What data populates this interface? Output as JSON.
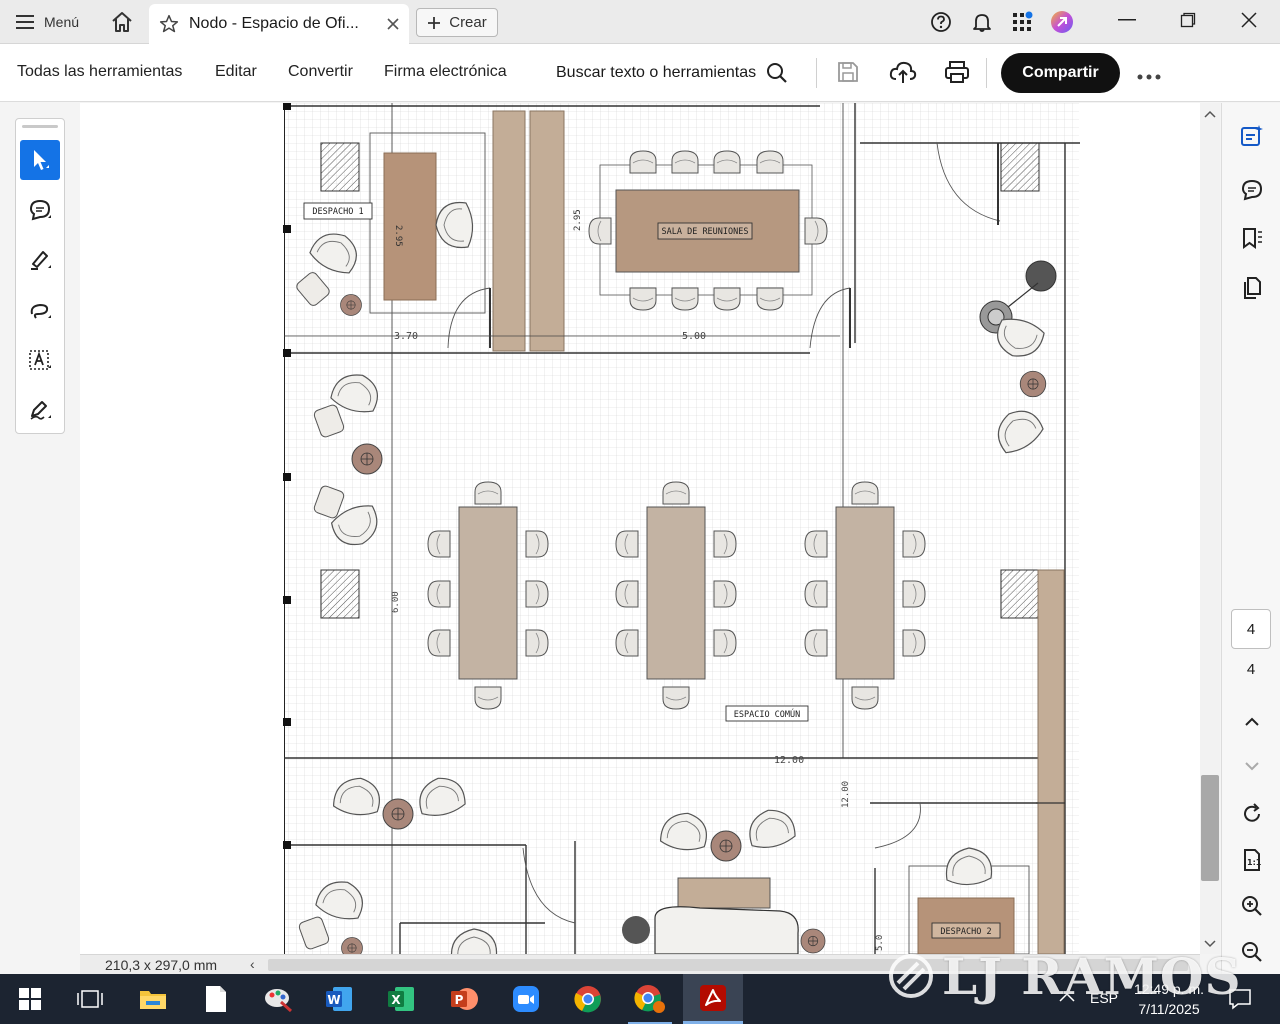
{
  "titlebar": {
    "menu_label": "Menú",
    "tab_title": "Nodo - Espacio de Ofi...",
    "create_label": "Crear"
  },
  "toolbar": {
    "items": [
      "Todas las herramientas",
      "Editar",
      "Convertir",
      "Firma electrónica"
    ],
    "search_label": "Buscar texto o herramientas",
    "share_label": "Compartir"
  },
  "floorplan": {
    "labels": {
      "office1": "DESPACHO 1",
      "meeting": "SALA DE REUNIONES",
      "common": "ESPACIO COMÚN",
      "office2": "DESPACHO 2"
    },
    "dimensions": {
      "d1": "3.70",
      "d2": "5.00",
      "d3": "2.95",
      "d4": "2.95",
      "d5": "6.00",
      "d6": "12.00",
      "d7": "12.00",
      "d8": "5.0"
    }
  },
  "navigation": {
    "current_page": "4",
    "total_pages": "4"
  },
  "statusbar": {
    "page_size": "210,3 x 297,0 mm"
  },
  "taskbar": {
    "language": "ESP",
    "time": "12:49 p. m.",
    "date": "7/11/2025"
  },
  "watermark": {
    "text": "LJ RAMOS"
  },
  "colors": {
    "accent": "#1473e6",
    "table_wood": "#c3b3a3",
    "meeting_table": "#b69880",
    "office_desk": "#b69379",
    "taskbar": "#1c2431"
  }
}
